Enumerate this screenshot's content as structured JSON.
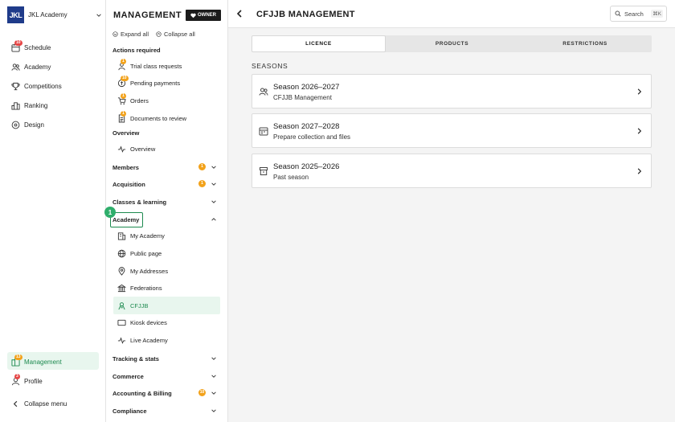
{
  "org": {
    "logo_text": "JKL",
    "name": "JKL Academy"
  },
  "leftnav": {
    "items": [
      {
        "label": "Schedule",
        "icon": "calendar-icon",
        "badge": "10"
      },
      {
        "label": "Academy",
        "icon": "users-icon"
      },
      {
        "label": "Competitions",
        "icon": "trophy-icon"
      },
      {
        "label": "Ranking",
        "icon": "podium-icon"
      },
      {
        "label": "Design",
        "icon": "palette-icon"
      }
    ],
    "management": {
      "label": "Management",
      "icon": "management-icon",
      "badge": "13"
    },
    "profile": {
      "label": "Profile",
      "icon": "profile-icon",
      "badge": "3"
    },
    "collapse": "Collapse menu"
  },
  "menu": {
    "title": "MANAGEMENT",
    "owner_badge": "OWNER",
    "expand_all": "Expand all",
    "collapse_all": "Collapse all",
    "actions_required": {
      "label": "Actions required",
      "items": [
        {
          "label": "Trial class requests",
          "badge": "1"
        },
        {
          "label": "Pending payments",
          "badge": "10"
        },
        {
          "label": "Orders",
          "badge": "1"
        },
        {
          "label": "Documents to review",
          "badge": "1"
        }
      ]
    },
    "overview": {
      "label": "Overview",
      "item": "Overview"
    },
    "groups": {
      "members": {
        "label": "Members",
        "badge": "1"
      },
      "acquisition": {
        "label": "Acquisition",
        "badge": "1"
      },
      "classes": {
        "label": "Classes & learning"
      },
      "academy": {
        "label": "Academy"
      },
      "tracking": {
        "label": "Tracking & stats"
      },
      "commerce": {
        "label": "Commerce"
      },
      "accounting": {
        "label": "Accounting & Billing",
        "badge": "10"
      },
      "compliance": {
        "label": "Compliance"
      }
    },
    "academy_items": [
      {
        "label": "My Academy",
        "icon": "building-icon"
      },
      {
        "label": "Public page",
        "icon": "globe-icon"
      },
      {
        "label": "My Addresses",
        "icon": "location-pin-icon"
      },
      {
        "label": "Federations",
        "icon": "federation-icon"
      },
      {
        "label": "CFJJB",
        "icon": "cfjjb-icon",
        "active": true
      },
      {
        "label": "Kiosk devices",
        "icon": "tablet-icon"
      },
      {
        "label": "Live Academy",
        "icon": "pulse-icon"
      }
    ],
    "step_marker": "1"
  },
  "main": {
    "title": "CFJJB MANAGEMENT",
    "search": {
      "label": "Search",
      "shortcut": "⌘K"
    },
    "tabs": [
      {
        "label": "LICENCE",
        "active": true
      },
      {
        "label": "PRODUCTS"
      },
      {
        "label": "RESTRICTIONS"
      }
    ],
    "seasons_label": "SEASONS",
    "seasons": [
      {
        "title": "Season 2026–2027",
        "subtitle": "CFJJB Management",
        "icon": "users-icon"
      },
      {
        "title": "Season 2027–2028",
        "subtitle": "Prepare collection and files",
        "icon": "calendar-icon"
      },
      {
        "title": "Season 2025–2026",
        "subtitle": "Past season",
        "icon": "archive-icon"
      }
    ]
  },
  "colors": {
    "accent": "#1d8a4f",
    "badge_red": "#e64545",
    "badge_orange": "#f2a21b",
    "logo": "#1f3b8a"
  }
}
